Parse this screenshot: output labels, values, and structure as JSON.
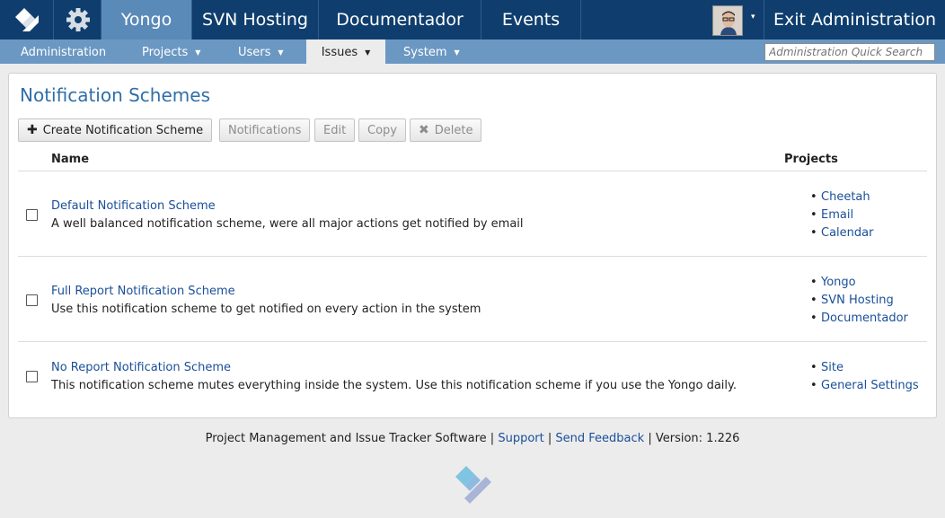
{
  "topnav": {
    "logo_icon": "yongo-logo-icon",
    "settings_icon": "gear-icon",
    "tabs": [
      {
        "label": "Yongo"
      },
      {
        "label": "SVN Hosting"
      },
      {
        "label": "Documentador"
      },
      {
        "label": "Events"
      }
    ],
    "user_avatar_icon": "avatar",
    "user_menu_caret": "▾",
    "exit_label": "Exit Administration"
  },
  "subnav": {
    "items": [
      {
        "label": "Administration"
      },
      {
        "label": "Projects"
      },
      {
        "label": "Users"
      },
      {
        "label": "Issues"
      },
      {
        "label": "System"
      }
    ],
    "caret": "▼",
    "quick_search_placeholder": "Administration Quick Search"
  },
  "page": {
    "title": "Notification Schemes",
    "toolbar": {
      "create_label": "Create Notification Scheme",
      "notifications_label": "Notifications",
      "edit_label": "Edit",
      "copy_label": "Copy",
      "delete_label": "Delete"
    },
    "columns": {
      "name": "Name",
      "projects": "Projects"
    },
    "rows": [
      {
        "name": "Default Notification Scheme",
        "description": "A well balanced notification scheme, were all major actions get notified by email",
        "projects": [
          "Cheetah",
          "Email",
          "Calendar"
        ]
      },
      {
        "name": "Full Report Notification Scheme",
        "description": "Use this notification scheme to get notified on every action in the system",
        "projects": [
          "Yongo",
          "SVN Hosting",
          "Documentador"
        ]
      },
      {
        "name": "No Report Notification Scheme",
        "description": "This notification scheme mutes everything inside the system. Use this notification scheme if you use the Yongo daily.",
        "projects": [
          "Site",
          "General Settings"
        ]
      }
    ]
  },
  "footer": {
    "text": "Project Management and Issue Tracker Software",
    "sep": "|",
    "support_label": "Support",
    "feedback_label": "Send Feedback",
    "version_text": "Version: 1.226"
  },
  "colors": {
    "topbar": "#0f3e6e",
    "active_tab": "#5a8ab8",
    "subbar": "#6b98c3",
    "link": "#1a4f99",
    "title": "#2f6fa8"
  }
}
